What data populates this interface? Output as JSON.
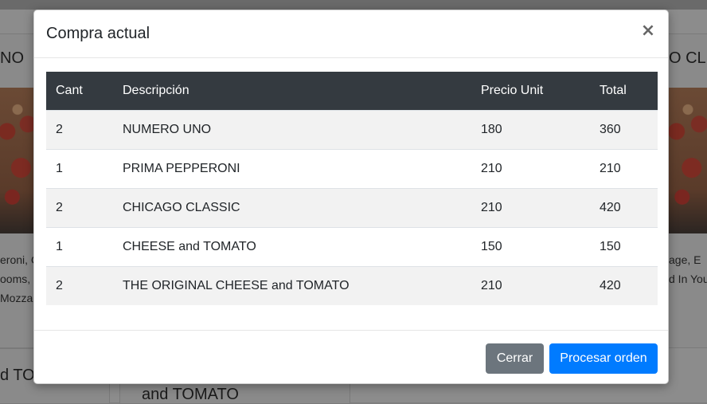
{
  "background": {
    "left_title": "NO",
    "right_title": "O CL",
    "left_desc_lines": [
      "eroni, C",
      "ooms,",
      "Mozza"
    ],
    "right_desc_lines": [
      "age, E",
      "d In You"
    ],
    "bottom_left_title": "d TO",
    "bottom_mid_title": "and TOMATO"
  },
  "modal": {
    "title": "Compra actual",
    "close_label": "×",
    "table": {
      "headers": [
        "Cant",
        "Descripción",
        "Precio Unit",
        "Total"
      ],
      "rows": [
        {
          "qty": "2",
          "desc": "NUMERO UNO",
          "price": "180",
          "total": "360"
        },
        {
          "qty": "1",
          "desc": "PRIMA PEPPERONI",
          "price": "210",
          "total": "210"
        },
        {
          "qty": "2",
          "desc": "CHICAGO CLASSIC",
          "price": "210",
          "total": "420"
        },
        {
          "qty": "1",
          "desc": "CHEESE and TOMATO",
          "price": "150",
          "total": "150"
        },
        {
          "qty": "2",
          "desc": "THE ORIGINAL CHEESE and TOMATO",
          "price": "210",
          "total": "420"
        }
      ]
    },
    "buttons": {
      "close": "Cerrar",
      "process": "Procesar orden"
    }
  },
  "colors": {
    "primary": "#007bff",
    "secondary": "#6c757d",
    "table_header": "#343a40",
    "overlay": "#7f7f7f"
  }
}
